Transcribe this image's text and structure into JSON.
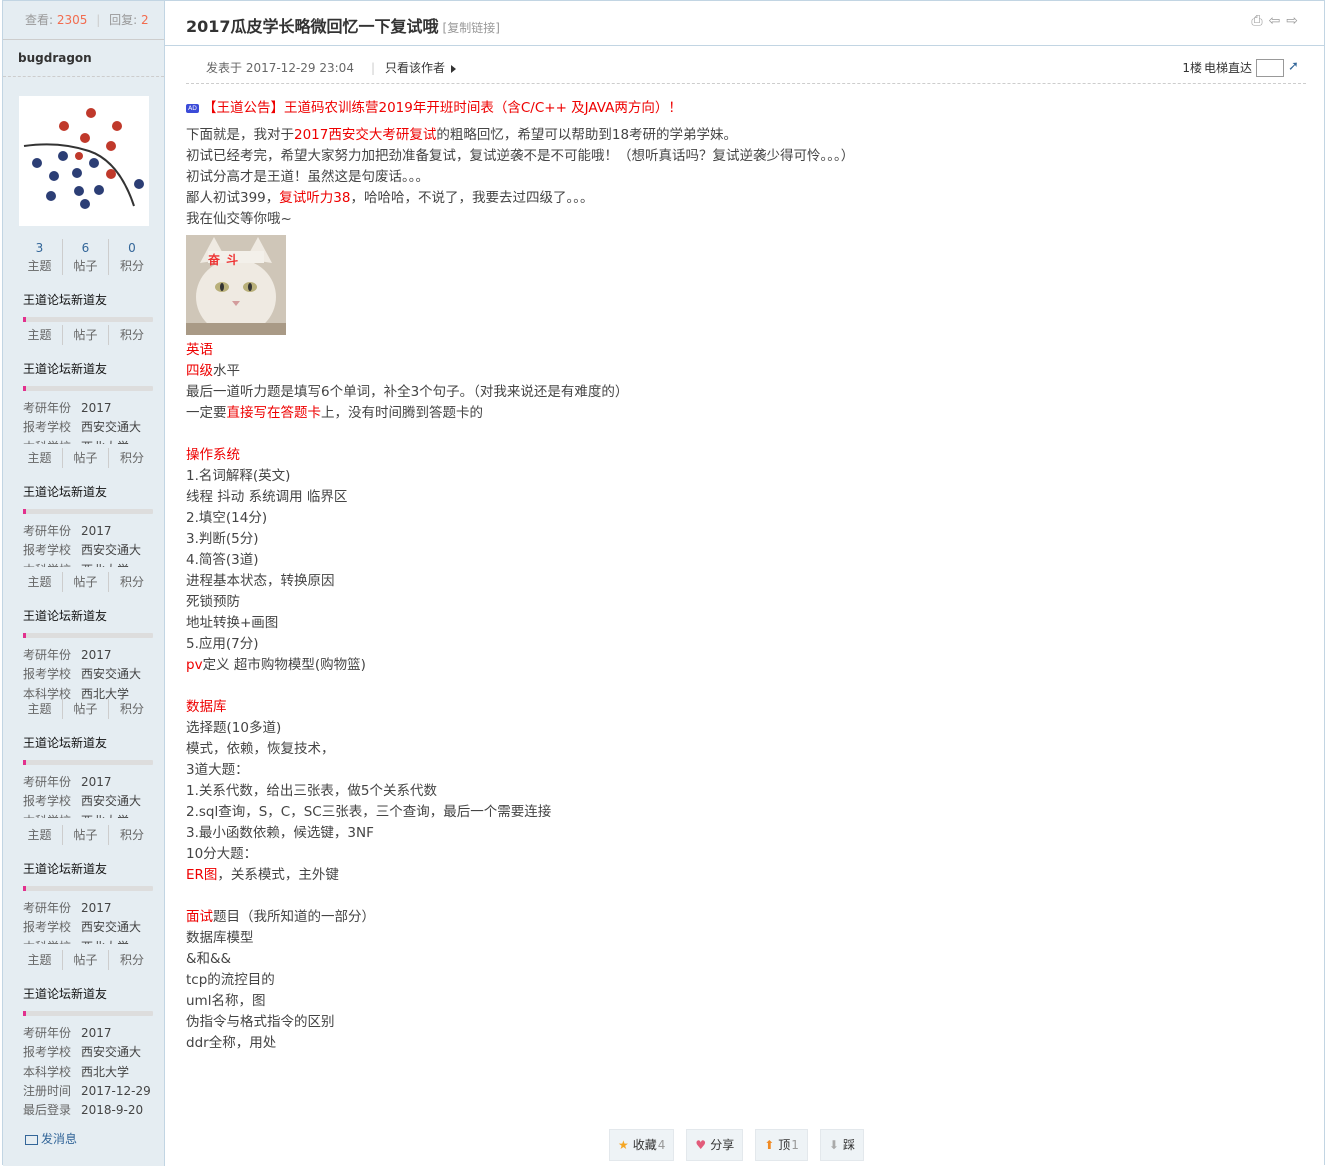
{
  "stats": {
    "view_label": "查看:",
    "views": "2305",
    "reply_label": "回复:",
    "replies": "2"
  },
  "user": {
    "name": "bugdragon",
    "threads": "3",
    "posts": "6",
    "points": "0",
    "threads_label": "主题",
    "posts_label": "帖子",
    "points_label": "积分",
    "rank": "王道论坛新道友",
    "info": [
      {
        "k": "考研年份",
        "v": "2017"
      },
      {
        "k": "报考学校",
        "v": "西安交通大"
      },
      {
        "k": "本科学校",
        "v": "西北大学"
      },
      {
        "k": "注册时间",
        "v": "2017-12-29"
      },
      {
        "k": "最后登录",
        "v": "2018-9-20"
      }
    ],
    "pm": "发消息"
  },
  "thread": {
    "title": "2017瓜皮学长略微回忆一下复试哦",
    "copy_link": "[复制链接]"
  },
  "post": {
    "posted": "发表于 2017-12-29 23:04",
    "only_author": "只看该作者",
    "floor": "1楼",
    "jump": "电梯直达"
  },
  "ad": {
    "text": "【王道公告】王道码农训练营2019年开班时间表（含C/C++ 及JAVA两方向）！",
    "tag": "AD"
  },
  "content": {
    "l1a": "下面就是，我对于",
    "l1r": "2017西安交大考研复试",
    "l1b": "的粗略回忆，希望可以帮助到18考研的学弟学妹。",
    "l2": "初试已经考完，希望大家努力加把劲准备复试，复试逆袭不是不可能哦！（想听真话吗？复试逆袭少得可怜。。。）",
    "l3": "初试分高才是王道！虽然这是句废话。。。",
    "l4a": "鄙人初试399，",
    "l4r": "复试听力38",
    "l4b": "，哈哈哈，不说了，我要去过四级了。。。",
    "l5": "我在仙交等你哦~",
    "cat_text": "奋 斗",
    "en_h": "英语",
    "en1r": "四级",
    "en1b": "水平",
    "en2": "最后一道听力题是填写6个单词，补全3个句子。（对我来说还是有难度的）",
    "en3a": "一定要",
    "en3r": "直接写在答题卡",
    "en3b": "上，没有时间腾到答题卡的",
    "os_h": "操作系统",
    "os": [
      "1.名词解释(英文)",
      "线程  抖动  系统调用  临界区",
      "2.填空(14分)",
      "3.判断(5分)",
      "4.简答(3道)",
      "进程基本状态，转换原因",
      "死锁预防",
      "地址转换+画图",
      "5.应用(7分)"
    ],
    "os_pv_r": "pv",
    "os_pv_b": "定义 超市购物模型(购物篮)",
    "db_h": "数据库",
    "db": [
      "选择题(10多道)",
      "模式，依赖，恢复技术，",
      "3道大题：",
      "1.关系代数，给出三张表，做5个关系代数",
      "2.sql查询，S，C，SC三张表，三个查询，最后一个需要连接",
      "3.最小函数依赖，候选键，3NF",
      "10分大题："
    ],
    "db_er_r": "ER图",
    "db_er_b": "，关系模式，主外键",
    "iv_r": "面试",
    "iv_b": "题目（我所知道的一部分）",
    "iv": [
      "数据库模型",
      "&和&&",
      "tcp的流控目的",
      "uml名称，图",
      "伪指令与格式指令的区别",
      "ddr全称，用处"
    ]
  },
  "actions": {
    "fav": "收藏",
    "fav_n": "4",
    "share": "分享",
    "up": "顶",
    "up_n": "1",
    "down": "踩"
  }
}
